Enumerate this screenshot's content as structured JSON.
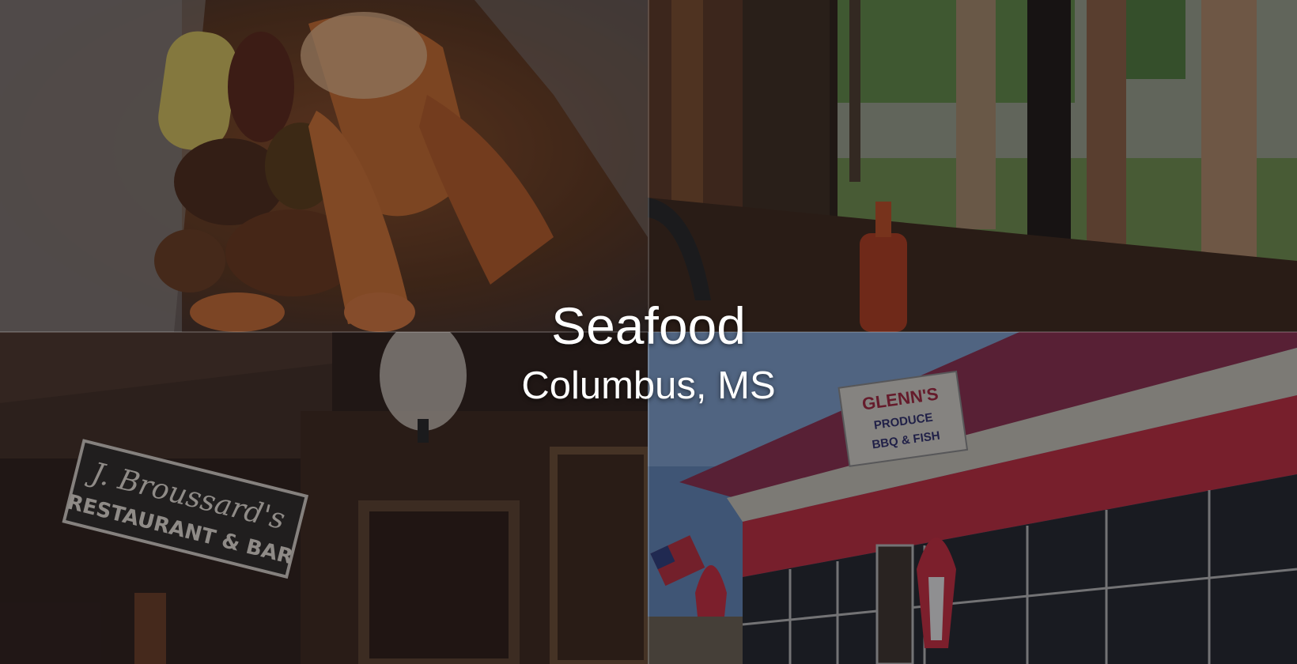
{
  "hero": {
    "title": "Seafood",
    "subtitle": "Columbus, MS"
  },
  "photos": [
    {
      "name": "seafood-boil-photo",
      "signage": []
    },
    {
      "name": "window-seating-photo",
      "signage": []
    },
    {
      "name": "broussards-interior-photo",
      "signage": [
        "J. Broussard's",
        "RESTAURANT & BAR"
      ]
    },
    {
      "name": "glenns-storefront-photo",
      "signage": [
        "GLENN'S",
        "PRODUCE",
        "BBQ & FISH"
      ]
    }
  ],
  "colors": {
    "overlay": "#141418",
    "title_text": "#ffffff",
    "storefront_red": "#c0283c",
    "sky": "#5f86b8"
  }
}
